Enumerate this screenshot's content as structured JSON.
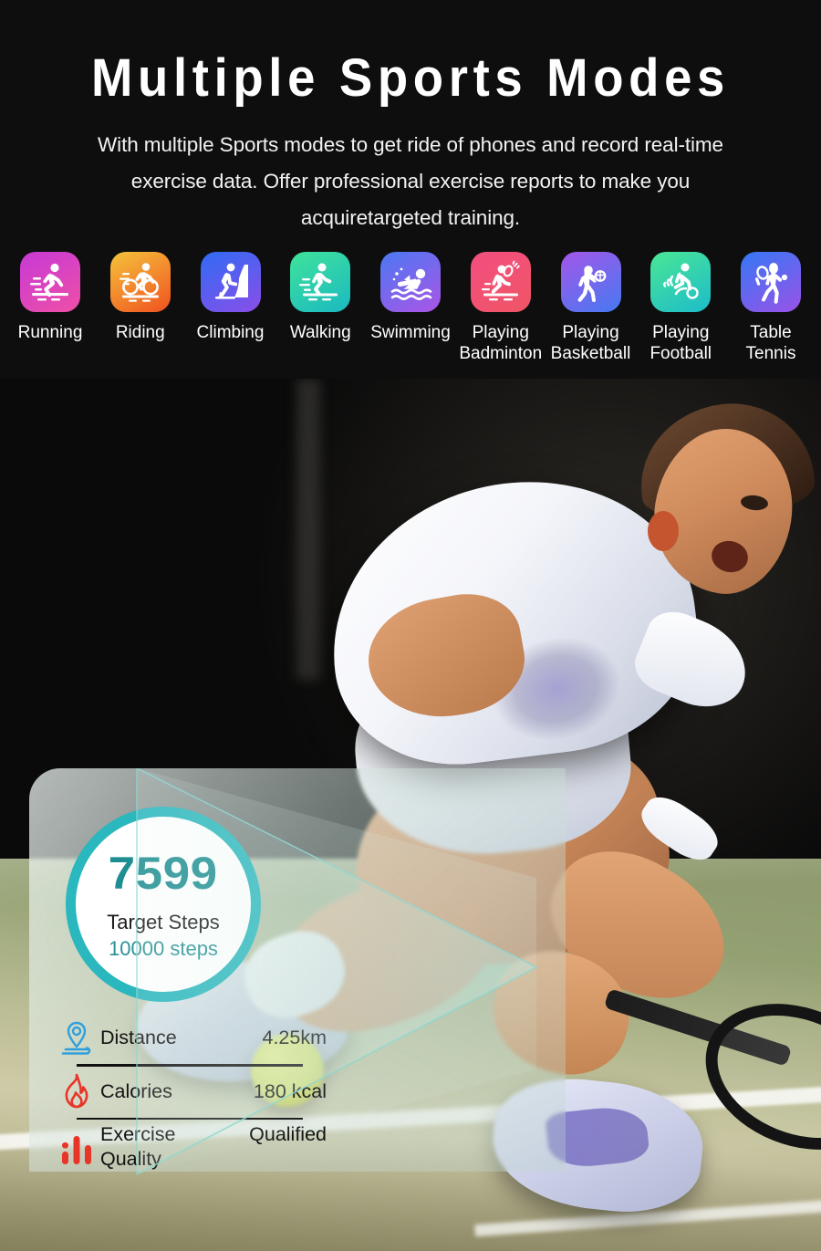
{
  "header": {
    "title": "Multiple Sports Modes",
    "subtitle": "With multiple Sports modes to get ride of phones and record real-time exercise data. Offer professional exercise reports to make you acquiretargeted training."
  },
  "sports_modes": [
    {
      "label": "Running",
      "icon": "running-icon",
      "gradient": [
        "#c93ad8",
        "#f255a6"
      ]
    },
    {
      "label": "Riding",
      "icon": "cycling-icon",
      "gradient": [
        "#f6c game",
        "#f05a28"
      ]
    },
    {
      "label": "Climbing",
      "icon": "climbing-icon",
      "gradient": [
        "#2b6df6",
        "#8a52e8"
      ]
    },
    {
      "label": "Walking",
      "icon": "walking-icon",
      "gradient": [
        "#3ce08f",
        "#1fbfc4"
      ]
    },
    {
      "label": "Swimming",
      "icon": "swimming-icon",
      "gradient": [
        "#4f7df2",
        "#a95ae6"
      ]
    },
    {
      "label": "Playing\nBadminton",
      "icon": "badminton-icon",
      "gradient": [
        "#f4527e",
        "#f0566a"
      ]
    },
    {
      "label": "Playing\nBasketball",
      "icon": "basketball-icon",
      "gradient": [
        "#a05ce8",
        "#4a7bf2"
      ]
    },
    {
      "label": "Playing\nFootball",
      "icon": "football-icon",
      "gradient": [
        "#46e58f",
        "#21bcc8"
      ]
    },
    {
      "label": "Table\nTennis",
      "icon": "table-tennis-icon",
      "gradient": [
        "#3a7bf6",
        "#9a5ce8"
      ]
    }
  ],
  "stats_panel": {
    "steps": {
      "value": "7599",
      "label": "Target Steps",
      "goal": "10000 steps",
      "ring_color": "#2ab7bd",
      "value_color": "#1f8e92"
    },
    "rows": [
      {
        "icon": "location-pin-icon",
        "name": "Distance",
        "value": "4.25km",
        "icon_color": "#2f9fdc"
      },
      {
        "icon": "flame-icon",
        "name": "Calories",
        "value": "180 kcal",
        "icon_color": "#e8352a"
      },
      {
        "icon": "bar-chart-icon",
        "name": "Exercise\nQuality",
        "value": "Qualified",
        "icon_color": "#e8352a"
      }
    ]
  },
  "photo": {
    "highlight": "watch-magnifier-rings",
    "subject": "tennis-player-wearing-smartwatch"
  }
}
